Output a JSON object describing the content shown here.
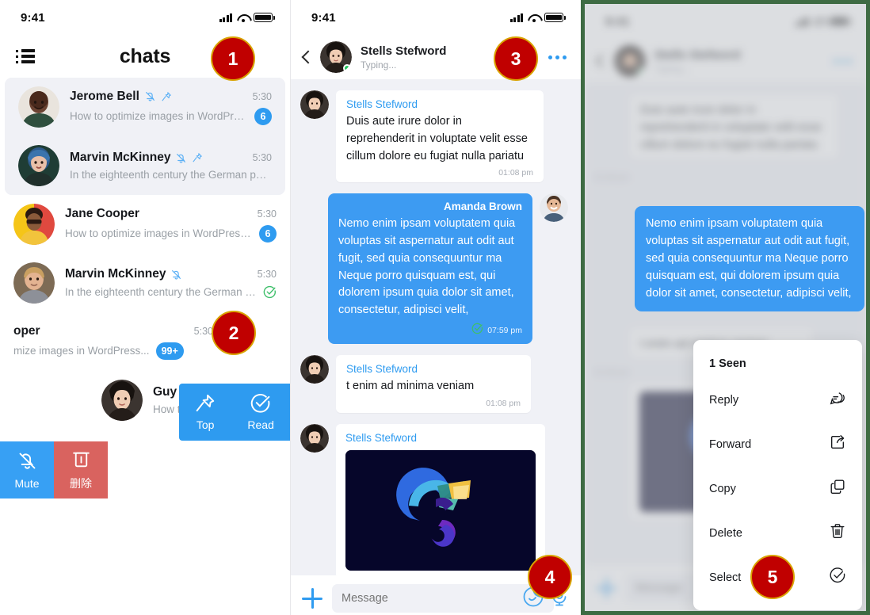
{
  "status_bar": {
    "time": "9:41",
    "signal_icon": "signal-bars-icon",
    "wifi_icon": "wifi-icon",
    "battery_icon": "battery-icon"
  },
  "left_panel": {
    "menu_icon": "list-menu-icon",
    "title": "chats",
    "rows": [
      {
        "name": "Jerome Bell",
        "time": "5:30",
        "preview": "How to optimize images in WordPress for...",
        "badge": "6",
        "muted": true,
        "pinned": true,
        "highlight": true,
        "avatar": "woman-green-top"
      },
      {
        "name": "Marvin McKinney",
        "time": "5:30",
        "preview": "In the eighteenth century the German philosoph...",
        "badge": "",
        "muted": true,
        "pinned": true,
        "highlight": true,
        "avatar": "woman-blue-hair"
      },
      {
        "name": "Jane Cooper",
        "time": "5:30",
        "preview": "How to optimize images in WordPress for...",
        "badge": "6",
        "muted": false,
        "pinned": false,
        "highlight": false,
        "avatar": "woman-yellow-red"
      },
      {
        "name": "Marvin McKinney",
        "time": "5:30",
        "preview": "In the eighteenth century the German philos...",
        "badge": "",
        "read_check": true,
        "muted": true,
        "pinned": false,
        "highlight": false,
        "avatar": "man-blond"
      },
      {
        "name": "oper",
        "time": "5:30",
        "preview": "mize images in WordPress...",
        "badge": "99+",
        "muted": false,
        "pinned": false,
        "highlight": false,
        "avatar": ""
      },
      {
        "name": "Guy Hawkins",
        "time": "",
        "preview": "How to optimize images in W",
        "badge": "",
        "muted": false,
        "pinned": false,
        "highlight": false,
        "avatar": "woman-dark-hair"
      }
    ],
    "swipe_right_actions": [
      {
        "label": "Top",
        "icon": "pin-icon"
      },
      {
        "label": "Read",
        "icon": "check-circle-icon"
      }
    ],
    "swipe_left_actions": [
      {
        "label": "Mute",
        "icon": "mute-bell-icon",
        "color": "#37a0f4"
      },
      {
        "label": "删除",
        "icon": "trash-icon",
        "color": "#d9635f"
      }
    ]
  },
  "middle_panel": {
    "header": {
      "back_icon": "back-chevron-icon",
      "name": "Stells Stefword",
      "status": "Typing...",
      "more_icon": "more-dots-icon",
      "online": true
    },
    "messages": [
      {
        "direction": "in",
        "sender": "Stells Stefword",
        "text": "Duis aute irure dolor in reprehenderit in voluptate velit esse cillum dolore eu fugiat nulla pariatu",
        "time": "01:08 pm",
        "avatar": "woman-dark-hair"
      },
      {
        "direction": "out",
        "sender": "Amanda Brown",
        "text": "Nemo enim ipsam voluptatem quia voluptas sit aspernatur aut odit aut fugit, sed quia consequuntur ma Neque porro quisquam est, qui dolorem ipsum quia dolor sit amet, consectetur, adipisci velit,",
        "time": "07:59 pm",
        "read_icon": "check-circle-icon",
        "avatar": "man-smiling"
      },
      {
        "direction": "in",
        "sender": "Stells Stefword",
        "text": "t enim ad minima veniam",
        "time": "01:08 pm",
        "avatar": "woman-dark-hair"
      },
      {
        "direction": "in",
        "sender": "Stells Stefword",
        "type": "image",
        "image_alt": "chameleon-logo-dark",
        "avatar": "woman-dark-hair"
      }
    ],
    "composer": {
      "add_icon": "plus-icon",
      "placeholder": "Message",
      "emoji_icon": "sticker-icon",
      "mic_icon": "microphone-icon"
    }
  },
  "right_panel": {
    "focused_message": {
      "text": "Nemo enim ipsam voluptatem quia voluptas sit aspernatur aut odit aut fugit, sed quia consequuntur ma Neque porro quisquam est, qui dolorem ipsum quia dolor sit amet, consectetur, adipisci velit,"
    },
    "context_menu": {
      "seen_label": "1 Seen",
      "items": [
        {
          "label": "Reply",
          "icon": "reply-bubble-icon"
        },
        {
          "label": "Forward",
          "icon": "forward-share-icon"
        },
        {
          "label": "Copy",
          "icon": "copy-icon"
        },
        {
          "label": "Delete",
          "icon": "trash-icon"
        },
        {
          "label": "Select",
          "icon": "check-circle-icon"
        }
      ]
    }
  },
  "markers": [
    {
      "number": "1"
    },
    {
      "number": "2"
    },
    {
      "number": "3"
    },
    {
      "number": "4"
    },
    {
      "number": "5"
    }
  ],
  "colors": {
    "accent_blue": "#2e9bf0",
    "bubble_blue": "#3d9bf2",
    "marker_red": "#c00000",
    "marker_ring": "#d9a300",
    "delete_red": "#d9635f",
    "bg_grey": "#f0f1f6",
    "frame_green": "#3e6b43",
    "online_green": "#22c55e"
  }
}
